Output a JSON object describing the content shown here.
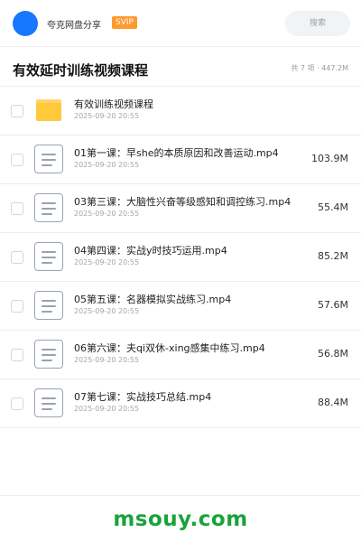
{
  "header": {
    "user_name": "夸克网盘分享",
    "badge": "SVIP",
    "search_placeholder": "搜索"
  },
  "folder": {
    "title": "有效延时训练视频课程",
    "summary": "共 7 项 · 447.2M"
  },
  "files": [
    {
      "name": "有效训练视频课程",
      "date": "2025-09-20 20:55",
      "size": "",
      "type": "folder"
    },
    {
      "name": "01第一课：早she的本质原因和改善运动.mp4",
      "date": "2025-09-20 20:55",
      "size": "103.9M",
      "type": "video"
    },
    {
      "name": "03第三课：大脑性兴奋等级感知和调控练习.mp4",
      "date": "2025-09-20 20:55",
      "size": "55.4M",
      "type": "video"
    },
    {
      "name": "04第四课：实战y时技巧运用.mp4",
      "date": "2025-09-20 20:55",
      "size": "85.2M",
      "type": "video"
    },
    {
      "name": "05第五课：名器模拟实战练习.mp4",
      "date": "2025-09-20 20:55",
      "size": "57.6M",
      "type": "video"
    },
    {
      "name": "06第六课：夫qi双休-xing感集中练习.mp4",
      "date": "2025-09-20 20:55",
      "size": "56.8M",
      "type": "video"
    },
    {
      "name": "07第七课：实战技巧总结.mp4",
      "date": "2025-09-20 20:55",
      "size": "88.4M",
      "type": "video"
    }
  ],
  "watermark": "msouy.com",
  "colors": {
    "accent": "#1677ff",
    "badge": "#ff9a2e",
    "folder": "#ffc93c",
    "watermark": "#19a33a"
  }
}
